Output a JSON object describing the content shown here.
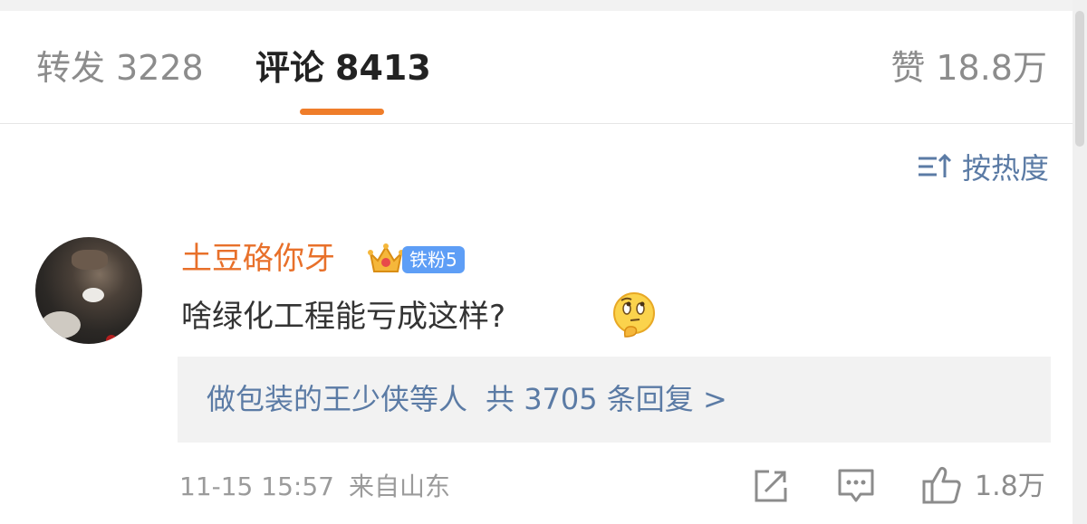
{
  "tabs": {
    "repost": {
      "label": "转发",
      "count": "3228"
    },
    "comment": {
      "label": "评论",
      "count": "8413"
    },
    "like": {
      "label": "赞",
      "count": "18.8万"
    }
  },
  "sort": {
    "label": "按热度",
    "icon": "sort-icon"
  },
  "comment": {
    "username": "土豆硌你牙",
    "fan_badge": "铁粉5",
    "text": "啥绿化工程能亏成这样?",
    "emoji": "thinking-face",
    "replies": {
      "names": "做包装的王少侠等人",
      "summary": "共 3705 条回复 >"
    },
    "timestamp": "11-15 15:57",
    "source": "来自山东",
    "like_count": "1.8万"
  },
  "colors": {
    "accent": "#ef7d2a",
    "username": "#e8702a",
    "link": "#5b7ba5",
    "badge": "#5e9ef6"
  }
}
